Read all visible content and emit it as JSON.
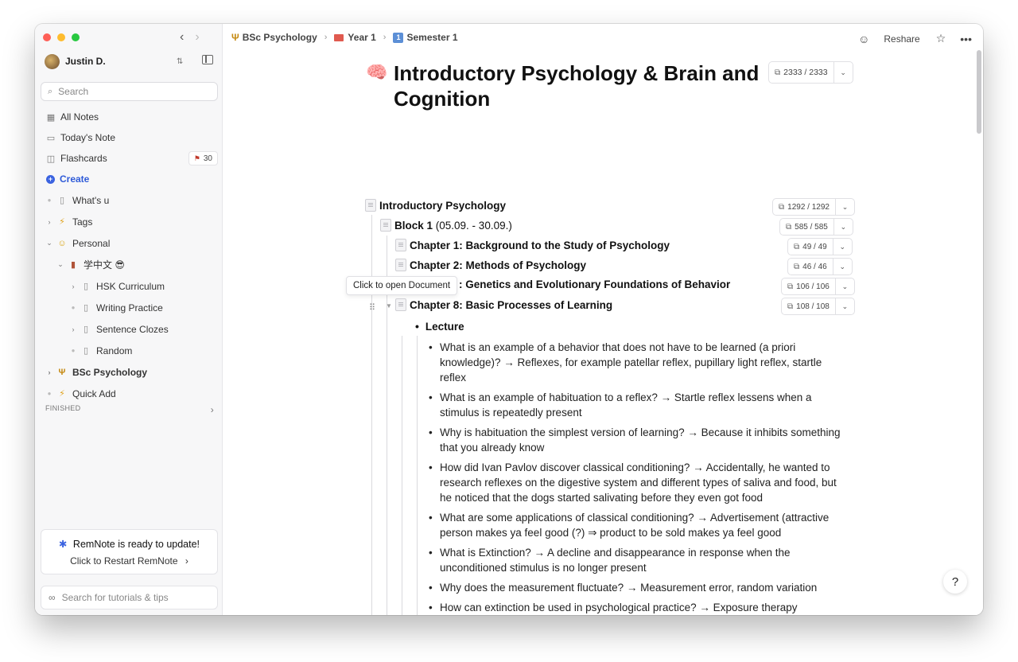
{
  "sidebar": {
    "user": {
      "name": "Justin D."
    },
    "search_placeholder": "Search",
    "nav": [
      {
        "label": "All Notes",
        "icon": "grid-icon"
      },
      {
        "label": "Today's Note",
        "icon": "calendar-icon"
      },
      {
        "label": "Flashcards",
        "icon": "cards-icon",
        "badge": "30"
      },
      {
        "label": "Create",
        "icon": "plus-circle-icon"
      }
    ],
    "tree": [
      {
        "label": "What's u",
        "level": 0,
        "type": "bullet"
      },
      {
        "label": "Tags",
        "level": 0,
        "type": "caret-right"
      },
      {
        "label": "Personal",
        "level": 0,
        "type": "caret-down"
      },
      {
        "label": "学中文 😎",
        "level": 1,
        "type": "caret-down"
      },
      {
        "label": "HSK Curriculum",
        "level": 2,
        "type": "caret-right"
      },
      {
        "label": "Writing Practice",
        "level": 2,
        "type": "bullet"
      },
      {
        "label": "Sentence Clozes",
        "level": 2,
        "type": "caret-right"
      },
      {
        "label": "Random",
        "level": 2,
        "type": "bullet"
      },
      {
        "label": "BSc Psychology",
        "level": 0,
        "type": "caret-right"
      },
      {
        "label": "Quick Add",
        "level": 0,
        "type": "bullet"
      }
    ],
    "finished_label": "FINISHED",
    "update": {
      "title": "RemNote is ready to update!",
      "link": "Click to Restart RemNote"
    },
    "tutorial_placeholder": "Search for tutorials & tips"
  },
  "breadcrumb": [
    {
      "label": "BSc Psychology"
    },
    {
      "label": "Year 1"
    },
    {
      "label": "Semester 1",
      "num": "1"
    }
  ],
  "top_actions": {
    "reshare": "Reshare"
  },
  "document": {
    "emoji": "🧠",
    "title": "Introductory Psychology & Brain and Cognition",
    "count": "2333 / 2333",
    "tooltip": "Click to open Document",
    "rows": [
      {
        "bold": "Introductory Psychology",
        "rest": "",
        "count": "1292 / 1292"
      },
      {
        "bold": "Block 1",
        "rest": " (05.09. - 30.09.)",
        "count": "585 / 585"
      },
      {
        "bold": "Chapter 1: Background to the Study of Psychology",
        "rest": "",
        "count": "49 / 49"
      },
      {
        "bold": "Chapter 2: Methods of Psychology",
        "rest": "",
        "count": "46 / 46"
      },
      {
        "bold": ": Genetics and Evolutionary Foundations of Behavior",
        "rest": "",
        "count": "106 / 106"
      },
      {
        "bold": "Chapter 8: Basic Processes of Learning",
        "rest": "",
        "count": "108 / 108"
      }
    ],
    "lecture_label": "Lecture",
    "qa": [
      "What is an example of a behavior that does not have to be learned (a priori knowledge)? → Reflexes, for example patellar reflex, pupillary light reflex, startle reflex",
      "What is an example of habituation to a reflex? → Startle reflex lessens when a stimulus is repeatedly present",
      "Why is habituation the simplest version of learning? → Because it inhibits something that you already know",
      "How did Ivan Pavlov discover classical conditioning? → Accidentally, he wanted to research reflexes on the digestive system and different types of saliva and food, but he noticed that the dogs started salivating before they even got food",
      "What are some applications of classical conditioning? → Advertisement (attractive person makes ya feel good (?) ⇒ product to be sold makes ya feel good",
      "What is Extinction? → A decline and disappearance in response when the unconditioned stimulus is no longer present",
      "Why does the measurement fluctuate? → Measurement error, random variation",
      "How can extinction be used in psychological practice? → Exposure therapy"
    ]
  },
  "help_label": "?"
}
